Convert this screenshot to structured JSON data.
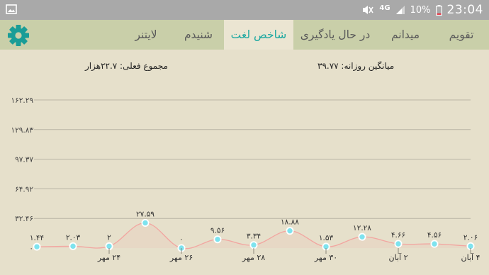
{
  "status_bar": {
    "network": "4G",
    "battery": "10%",
    "time": "23:04"
  },
  "tabs": [
    {
      "label": "تقویم",
      "active": false
    },
    {
      "label": "میدانم",
      "active": false
    },
    {
      "label": "در حال یادگیری",
      "active": false
    },
    {
      "label": "شاخص لغت",
      "active": true
    },
    {
      "label": "شنیدم",
      "active": false
    },
    {
      "label": "لایتنر",
      "active": false
    }
  ],
  "summary": {
    "daily_average": "میانگین روزانه: ۳۹.۷۷",
    "total": "مجموع فعلی: ۲۲.۷هزار"
  },
  "colors": {
    "accent": "#1aa7a0",
    "tab_bar": "#c9cfa9",
    "background": "#e6e0cb",
    "line": "#f2a5a0",
    "point": "#7ee3ee"
  },
  "chart_data": {
    "type": "line",
    "y_ticks": [
      "۰",
      "۳۲.۴۶",
      "۶۴.۹۲",
      "۹۷.۳۷",
      "۱۲۹.۸۳",
      "۱۶۲.۲۹"
    ],
    "ylim": [
      0,
      162.29
    ],
    "grid": true,
    "x_tick_labels": [
      "۲۴ مهر",
      "۲۶ مهر",
      "۲۸ مهر",
      "۳۰ مهر",
      "۲ آبان",
      "۴ آبان"
    ],
    "values": [
      1.44,
      2.03,
      2,
      27.59,
      0,
      9.56,
      3.34,
      18.88,
      1.53,
      12.28,
      4.66,
      4.56,
      2.06
    ],
    "value_labels": [
      "۱.۴۴",
      "۲.۰۳",
      "۲",
      "۲۷.۵۹",
      "۰",
      "۹.۵۶",
      "۳.۳۴",
      "۱۸.۸۸",
      "۱.۵۳",
      "۱۲.۲۸",
      "۴.۶۶",
      "۴.۵۶",
      "۲.۰۶"
    ]
  }
}
